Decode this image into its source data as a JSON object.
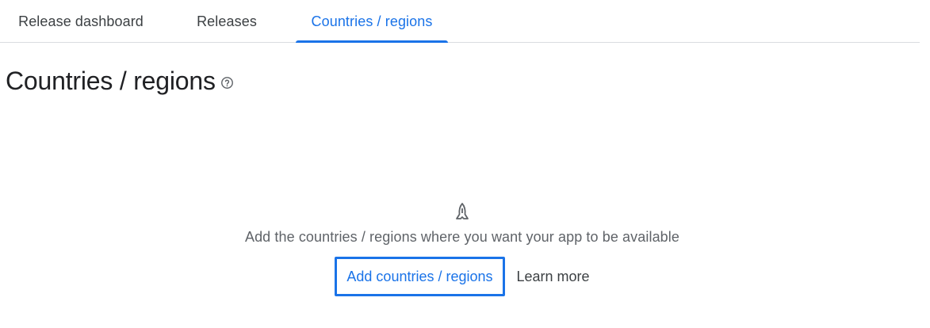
{
  "tabs": [
    {
      "label": "Release dashboard",
      "active": false
    },
    {
      "label": "Releases",
      "active": false
    },
    {
      "label": "Countries / regions",
      "active": true
    }
  ],
  "page": {
    "title": "Countries / regions",
    "help_icon": "help-circle-icon"
  },
  "empty_state": {
    "icon": "rocket-icon",
    "message": "Add the countries / regions where you want your app to be available",
    "primary_action": "Add countries / regions",
    "secondary_action": "Learn more"
  },
  "colors": {
    "accent": "#1a73e8",
    "text_primary": "#202124",
    "text_secondary": "#5f6368",
    "divider": "#dadce0"
  }
}
